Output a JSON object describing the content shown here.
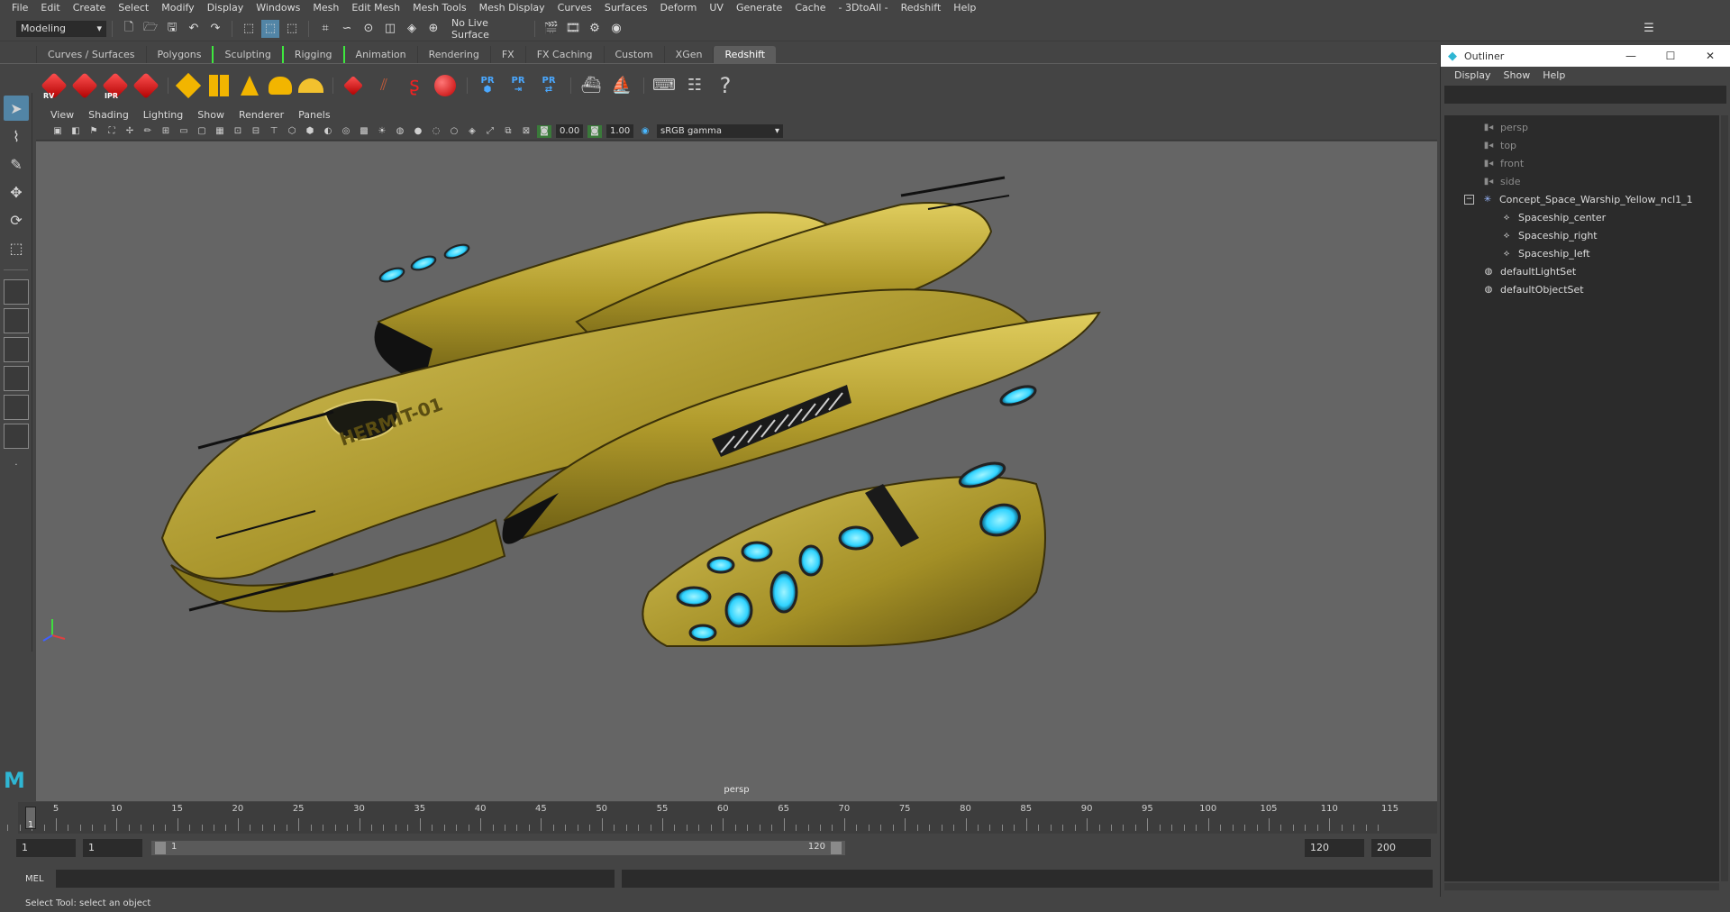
{
  "menubar": [
    "File",
    "Edit",
    "Create",
    "Select",
    "Modify",
    "Display",
    "Windows",
    "Mesh",
    "Edit Mesh",
    "Mesh Tools",
    "Mesh Display",
    "Curves",
    "Surfaces",
    "Deform",
    "UV",
    "Generate",
    "Cache",
    "- 3DtoAll -",
    "Redshift",
    "Help"
  ],
  "statusline": {
    "mode": "Modeling",
    "live_surface": "No Live Surface"
  },
  "shelf_tabs": [
    "Curves / Surfaces",
    "Polygons",
    "Sculpting",
    "Rigging",
    "Animation",
    "Rendering",
    "FX",
    "FX Caching",
    "Custom",
    "XGen",
    "Redshift"
  ],
  "shelf_active_tab": "Redshift",
  "shelf_icons": {
    "rv": "RV",
    "ipr": "IPR",
    "pr": "PR"
  },
  "viewport": {
    "menu": [
      "View",
      "Shading",
      "Lighting",
      "Show",
      "Renderer",
      "Panels"
    ],
    "exposure": "0.00",
    "gamma": "1.00",
    "colorspace": "sRGB gamma",
    "camera": "persp",
    "model_label": "HERMIT-01"
  },
  "timeline": {
    "current_frame": "1",
    "ticks": [
      "5",
      "10",
      "15",
      "20",
      "25",
      "30",
      "35",
      "40",
      "45",
      "50",
      "55",
      "60",
      "65",
      "70",
      "75",
      "80",
      "85",
      "90",
      "95",
      "100",
      "105",
      "110",
      "115"
    ]
  },
  "range": {
    "start": "1",
    "playback_start": "1",
    "range_start": "1",
    "range_end": "120",
    "playback_end": "120",
    "end": "200"
  },
  "cmdline": {
    "label": "MEL"
  },
  "helpline": "Select Tool: select an object",
  "outliner": {
    "title": "Outliner",
    "menu": [
      "Display",
      "Show",
      "Help"
    ],
    "items": [
      {
        "label": "persp",
        "dim": true
      },
      {
        "label": "top",
        "dim": true
      },
      {
        "label": "front",
        "dim": true
      },
      {
        "label": "side",
        "dim": true
      },
      {
        "label": "Concept_Space_Warship_Yellow_ncl1_1",
        "dim": false
      },
      {
        "label": "Spaceship_center",
        "dim": false
      },
      {
        "label": "Spaceship_right",
        "dim": false
      },
      {
        "label": "Spaceship_left",
        "dim": false
      },
      {
        "label": "defaultLightSet",
        "dim": false
      },
      {
        "label": "defaultObjectSet",
        "dim": false
      }
    ]
  },
  "colors": {
    "accent": "#5285a6",
    "ship": "#b5a02e",
    "glow": "#3fd8ff",
    "viewport_bg": "#656565"
  }
}
